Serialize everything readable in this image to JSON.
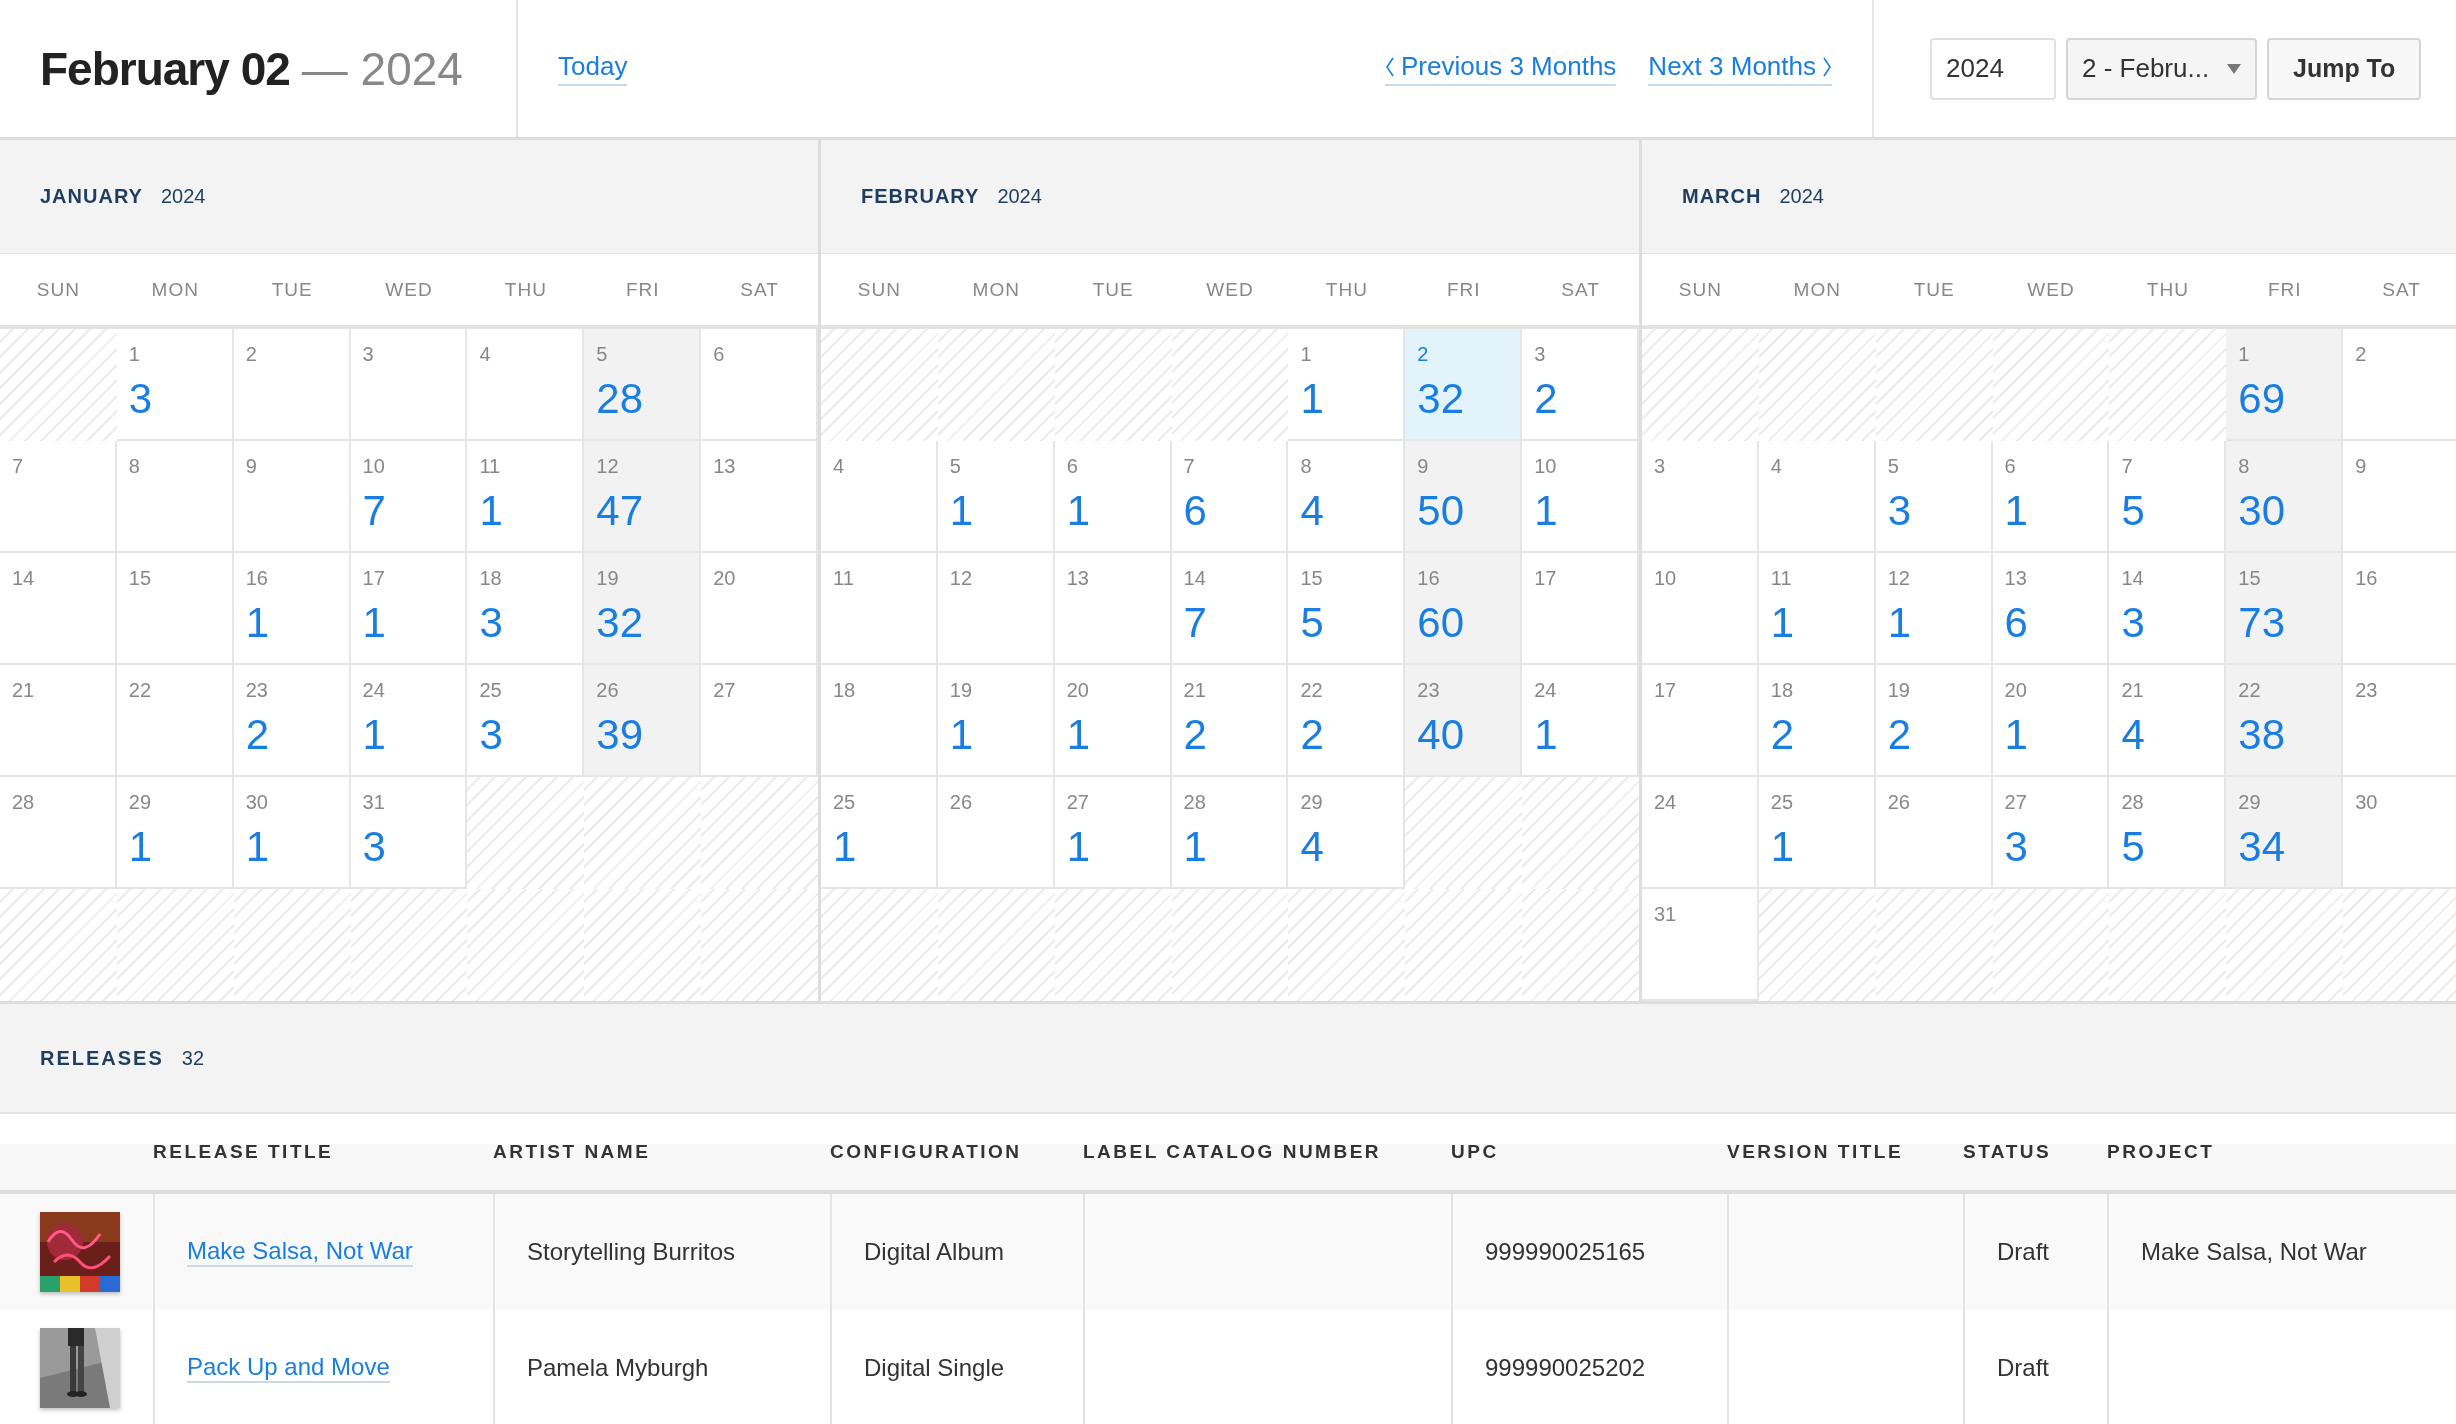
{
  "header": {
    "date": "February 02",
    "year": "— 2024",
    "today_link": "Today",
    "previous_link": "Previous 3 Months",
    "next_link": "Next 3 Months",
    "year_field": {
      "value": "2024"
    },
    "month_select": {
      "value": "2 - Febru..."
    },
    "jump_button": "Jump To"
  },
  "months": [
    {
      "name": "JANUARY",
      "year": "2024",
      "weekdays": [
        "SUN",
        "MON",
        "TUE",
        "WED",
        "THU",
        "FRI",
        "SAT"
      ],
      "weeks": [
        [
          {
            "kind": "blank"
          },
          {
            "kind": "day",
            "day": "1",
            "count": "3",
            "selected": false,
            "highlighted": false
          },
          {
            "kind": "day",
            "day": "2",
            "selected": false,
            "highlighted": false
          },
          {
            "kind": "day",
            "day": "3",
            "selected": false,
            "highlighted": false
          },
          {
            "kind": "day",
            "day": "4",
            "selected": false,
            "highlighted": false
          },
          {
            "kind": "day",
            "day": "5",
            "count": "28",
            "selected": false,
            "highlighted": true
          },
          {
            "kind": "day",
            "day": "6",
            "selected": false,
            "highlighted": false
          }
        ],
        [
          {
            "kind": "day",
            "day": "7",
            "selected": false,
            "highlighted": false
          },
          {
            "kind": "day",
            "day": "8",
            "selected": false,
            "highlighted": false
          },
          {
            "kind": "day",
            "day": "9",
            "selected": false,
            "highlighted": false
          },
          {
            "kind": "day",
            "day": "10",
            "count": "7",
            "selected": false,
            "highlighted": false
          },
          {
            "kind": "day",
            "day": "11",
            "count": "1",
            "selected": false,
            "highlighted": false
          },
          {
            "kind": "day",
            "day": "12",
            "count": "47",
            "selected": false,
            "highlighted": true
          },
          {
            "kind": "day",
            "day": "13",
            "selected": false,
            "highlighted": false
          }
        ],
        [
          {
            "kind": "day",
            "day": "14",
            "selected": false,
            "highlighted": false
          },
          {
            "kind": "day",
            "day": "15",
            "selected": false,
            "highlighted": false
          },
          {
            "kind": "day",
            "day": "16",
            "count": "1",
            "selected": false,
            "highlighted": false
          },
          {
            "kind": "day",
            "day": "17",
            "count": "1",
            "selected": false,
            "highlighted": false
          },
          {
            "kind": "day",
            "day": "18",
            "count": "3",
            "selected": false,
            "highlighted": false
          },
          {
            "kind": "day",
            "day": "19",
            "count": "32",
            "selected": false,
            "highlighted": true
          },
          {
            "kind": "day",
            "day": "20",
            "selected": false,
            "highlighted": false
          }
        ],
        [
          {
            "kind": "day",
            "day": "21",
            "selected": false,
            "highlighted": false
          },
          {
            "kind": "day",
            "day": "22",
            "selected": false,
            "highlighted": false
          },
          {
            "kind": "day",
            "day": "23",
            "count": "2",
            "selected": false,
            "highlighted": false
          },
          {
            "kind": "day",
            "day": "24",
            "count": "1",
            "selected": false,
            "highlighted": false
          },
          {
            "kind": "day",
            "day": "25",
            "count": "3",
            "selected": false,
            "highlighted": false
          },
          {
            "kind": "day",
            "day": "26",
            "count": "39",
            "selected": false,
            "highlighted": true
          },
          {
            "kind": "day",
            "day": "27",
            "selected": false,
            "highlighted": false
          }
        ],
        [
          {
            "kind": "day",
            "day": "28",
            "selected": false,
            "highlighted": false
          },
          {
            "kind": "day",
            "day": "29",
            "count": "1",
            "selected": false,
            "highlighted": false
          },
          {
            "kind": "day",
            "day": "30",
            "count": "1",
            "selected": false,
            "highlighted": false
          },
          {
            "kind": "day",
            "day": "31",
            "count": "3",
            "selected": false,
            "highlighted": false
          },
          {
            "kind": "blank"
          },
          {
            "kind": "blank"
          },
          {
            "kind": "blank"
          }
        ],
        [
          {
            "kind": "blank"
          },
          {
            "kind": "blank"
          },
          {
            "kind": "blank"
          },
          {
            "kind": "blank"
          },
          {
            "kind": "blank"
          },
          {
            "kind": "blank"
          },
          {
            "kind": "blank"
          }
        ]
      ]
    },
    {
      "name": "FEBRUARY",
      "year": "2024",
      "weekdays": [
        "SUN",
        "MON",
        "TUE",
        "WED",
        "THU",
        "FRI",
        "SAT"
      ],
      "weeks": [
        [
          {
            "kind": "blank"
          },
          {
            "kind": "blank"
          },
          {
            "kind": "blank"
          },
          {
            "kind": "blank"
          },
          {
            "kind": "day",
            "day": "1",
            "count": "1",
            "selected": false,
            "highlighted": false
          },
          {
            "kind": "day",
            "day": "2",
            "count": "32",
            "selected": true,
            "highlighted": true
          },
          {
            "kind": "day",
            "day": "3",
            "count": "2",
            "selected": false,
            "highlighted": false
          }
        ],
        [
          {
            "kind": "day",
            "day": "4",
            "selected": false,
            "highlighted": false
          },
          {
            "kind": "day",
            "day": "5",
            "count": "1",
            "selected": false,
            "highlighted": false
          },
          {
            "kind": "day",
            "day": "6",
            "count": "1",
            "selected": false,
            "highlighted": false
          },
          {
            "kind": "day",
            "day": "7",
            "count": "6",
            "selected": false,
            "highlighted": false
          },
          {
            "kind": "day",
            "day": "8",
            "count": "4",
            "selected": false,
            "highlighted": false
          },
          {
            "kind": "day",
            "day": "9",
            "count": "50",
            "selected": false,
            "highlighted": true
          },
          {
            "kind": "day",
            "day": "10",
            "count": "1",
            "selected": false,
            "highlighted": false
          }
        ],
        [
          {
            "kind": "day",
            "day": "11",
            "selected": false,
            "highlighted": false
          },
          {
            "kind": "day",
            "day": "12",
            "selected": false,
            "highlighted": false
          },
          {
            "kind": "day",
            "day": "13",
            "selected": false,
            "highlighted": false
          },
          {
            "kind": "day",
            "day": "14",
            "count": "7",
            "selected": false,
            "highlighted": false
          },
          {
            "kind": "day",
            "day": "15",
            "count": "5",
            "selected": false,
            "highlighted": false
          },
          {
            "kind": "day",
            "day": "16",
            "count": "60",
            "selected": false,
            "highlighted": true
          },
          {
            "kind": "day",
            "day": "17",
            "selected": false,
            "highlighted": false
          }
        ],
        [
          {
            "kind": "day",
            "day": "18",
            "selected": false,
            "highlighted": false
          },
          {
            "kind": "day",
            "day": "19",
            "count": "1",
            "selected": false,
            "highlighted": false
          },
          {
            "kind": "day",
            "day": "20",
            "count": "1",
            "selected": false,
            "highlighted": false
          },
          {
            "kind": "day",
            "day": "21",
            "count": "2",
            "selected": false,
            "highlighted": false
          },
          {
            "kind": "day",
            "day": "22",
            "count": "2",
            "selected": false,
            "highlighted": false
          },
          {
            "kind": "day",
            "day": "23",
            "count": "40",
            "selected": false,
            "highlighted": true
          },
          {
            "kind": "day",
            "day": "24",
            "count": "1",
            "selected": false,
            "highlighted": false
          }
        ],
        [
          {
            "kind": "day",
            "day": "25",
            "count": "1",
            "selected": false,
            "highlighted": false
          },
          {
            "kind": "day",
            "day": "26",
            "selected": false,
            "highlighted": false
          },
          {
            "kind": "day",
            "day": "27",
            "count": "1",
            "selected": false,
            "highlighted": false
          },
          {
            "kind": "day",
            "day": "28",
            "count": "1",
            "selected": false,
            "highlighted": false
          },
          {
            "kind": "day",
            "day": "29",
            "count": "4",
            "selected": false,
            "highlighted": false
          },
          {
            "kind": "blank"
          },
          {
            "kind": "blank"
          }
        ],
        [
          {
            "kind": "blank"
          },
          {
            "kind": "blank"
          },
          {
            "kind": "blank"
          },
          {
            "kind": "blank"
          },
          {
            "kind": "blank"
          },
          {
            "kind": "blank"
          },
          {
            "kind": "blank"
          }
        ]
      ]
    },
    {
      "name": "MARCH",
      "year": "2024",
      "weekdays": [
        "SUN",
        "MON",
        "TUE",
        "WED",
        "THU",
        "FRI",
        "SAT"
      ],
      "weeks": [
        [
          {
            "kind": "blank"
          },
          {
            "kind": "blank"
          },
          {
            "kind": "blank"
          },
          {
            "kind": "blank"
          },
          {
            "kind": "blank"
          },
          {
            "kind": "day",
            "day": "1",
            "count": "69",
            "selected": false,
            "highlighted": true
          },
          {
            "kind": "day",
            "day": "2",
            "selected": false,
            "highlighted": false
          }
        ],
        [
          {
            "kind": "day",
            "day": "3",
            "selected": false,
            "highlighted": false
          },
          {
            "kind": "day",
            "day": "4",
            "selected": false,
            "highlighted": false
          },
          {
            "kind": "day",
            "day": "5",
            "count": "3",
            "selected": false,
            "highlighted": false
          },
          {
            "kind": "day",
            "day": "6",
            "count": "1",
            "selected": false,
            "highlighted": false
          },
          {
            "kind": "day",
            "day": "7",
            "count": "5",
            "selected": false,
            "highlighted": false
          },
          {
            "kind": "day",
            "day": "8",
            "count": "30",
            "selected": false,
            "highlighted": true
          },
          {
            "kind": "day",
            "day": "9",
            "selected": false,
            "highlighted": false
          }
        ],
        [
          {
            "kind": "day",
            "day": "10",
            "selected": false,
            "highlighted": false
          },
          {
            "kind": "day",
            "day": "11",
            "count": "1",
            "selected": false,
            "highlighted": false
          },
          {
            "kind": "day",
            "day": "12",
            "count": "1",
            "selected": false,
            "highlighted": false
          },
          {
            "kind": "day",
            "day": "13",
            "count": "6",
            "selected": false,
            "highlighted": false
          },
          {
            "kind": "day",
            "day": "14",
            "count": "3",
            "selected": false,
            "highlighted": false
          },
          {
            "kind": "day",
            "day": "15",
            "count": "73",
            "selected": false,
            "highlighted": true
          },
          {
            "kind": "day",
            "day": "16",
            "selected": false,
            "highlighted": false
          }
        ],
        [
          {
            "kind": "day",
            "day": "17",
            "selected": false,
            "highlighted": false
          },
          {
            "kind": "day",
            "day": "18",
            "count": "2",
            "selected": false,
            "highlighted": false
          },
          {
            "kind": "day",
            "day": "19",
            "count": "2",
            "selected": false,
            "highlighted": false
          },
          {
            "kind": "day",
            "day": "20",
            "count": "1",
            "selected": false,
            "highlighted": false
          },
          {
            "kind": "day",
            "day": "21",
            "count": "4",
            "selected": false,
            "highlighted": false
          },
          {
            "kind": "day",
            "day": "22",
            "count": "38",
            "selected": false,
            "highlighted": true
          },
          {
            "kind": "day",
            "day": "23",
            "selected": false,
            "highlighted": false
          }
        ],
        [
          {
            "kind": "day",
            "day": "24",
            "selected": false,
            "highlighted": false
          },
          {
            "kind": "day",
            "day": "25",
            "count": "1",
            "selected": false,
            "highlighted": false
          },
          {
            "kind": "day",
            "day": "26",
            "selected": false,
            "highlighted": false
          },
          {
            "kind": "day",
            "day": "27",
            "count": "3",
            "selected": false,
            "highlighted": false
          },
          {
            "kind": "day",
            "day": "28",
            "count": "5",
            "selected": false,
            "highlighted": false
          },
          {
            "kind": "day",
            "day": "29",
            "count": "34",
            "selected": false,
            "highlighted": true
          },
          {
            "kind": "day",
            "day": "30",
            "selected": false,
            "highlighted": false
          }
        ],
        [
          {
            "kind": "day",
            "day": "31",
            "selected": false,
            "highlighted": false
          },
          {
            "kind": "blank"
          },
          {
            "kind": "blank"
          },
          {
            "kind": "blank"
          },
          {
            "kind": "blank"
          },
          {
            "kind": "blank"
          },
          {
            "kind": "blank"
          }
        ]
      ]
    }
  ],
  "releases": {
    "title": "RELEASES",
    "count": "32",
    "columns": [
      "RELEASE TITLE",
      "ARTIST NAME",
      "CONFIGURATION",
      "LABEL CATALOG NUMBER",
      "UPC",
      "VERSION TITLE",
      "STATUS",
      "PROJECT"
    ],
    "rows": [
      {
        "release_title": "Make Salsa, Not War",
        "artist_name": "Storytelling Burritos",
        "configuration": "Digital Album",
        "upc": "999990025165",
        "status": "Draft",
        "project": "Make Salsa, Not War"
      },
      {
        "release_title": "Pack Up and Move",
        "artist_name": "Pamela Myburgh",
        "configuration": "Digital Single",
        "upc": "999990025202",
        "status": "Draft"
      }
    ]
  }
}
